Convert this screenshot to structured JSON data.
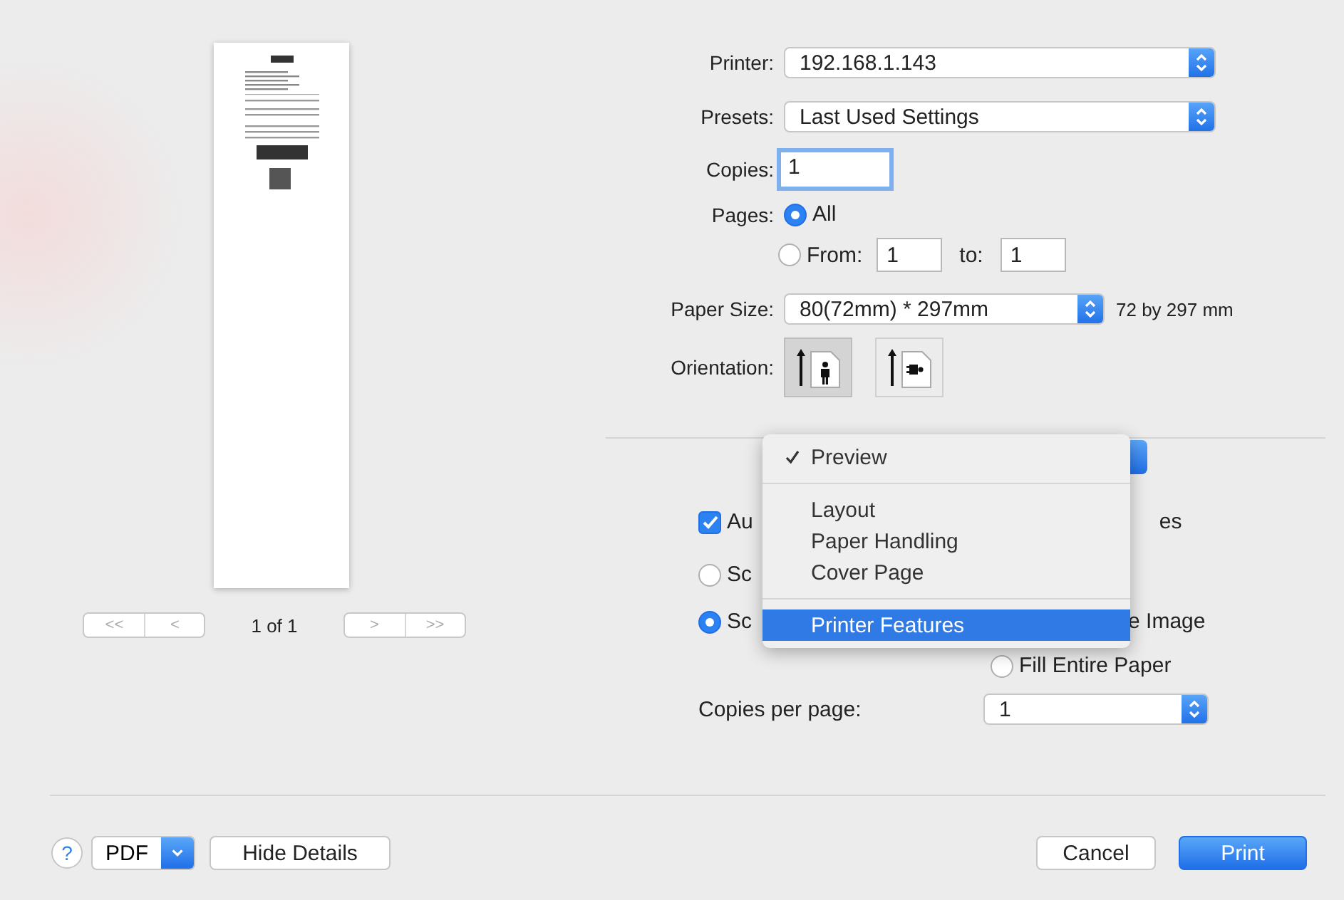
{
  "preview": {
    "page_label": "1 of 1",
    "nav_first": "<<",
    "nav_prev": "<",
    "nav_next": ">",
    "nav_last": ">>"
  },
  "form": {
    "printer": {
      "label": "Printer:",
      "value": "192.168.1.143"
    },
    "presets": {
      "label": "Presets:",
      "value": "Last Used Settings"
    },
    "copies": {
      "label": "Copies:",
      "value": "1"
    },
    "pages": {
      "label": "Pages:",
      "options": [
        {
          "label": "All",
          "selected": true
        },
        {
          "label": "From:",
          "selected": false
        }
      ],
      "from": "1",
      "to_label": "to:",
      "to": "1"
    },
    "paper_size": {
      "label": "Paper Size:",
      "value": "80(72mm) * 297mm",
      "note": "72 by 297 mm"
    },
    "orientation": {
      "label": "Orientation:",
      "options": [
        {
          "kind": "portrait",
          "selected": true
        },
        {
          "kind": "landscape",
          "selected": false
        }
      ]
    }
  },
  "section_menu": {
    "groups": [
      [
        {
          "label": "Preview",
          "checked": true,
          "selected": false
        }
      ],
      [
        {
          "label": "Layout",
          "checked": false,
          "selected": false
        },
        {
          "label": "Paper Handling",
          "checked": false,
          "selected": false
        },
        {
          "label": "Cover Page",
          "checked": false,
          "selected": false
        }
      ],
      [
        {
          "label": "Printer Features",
          "checked": false,
          "selected": true
        }
      ]
    ]
  },
  "options": {
    "auto": {
      "label_start": "Au",
      "label_end": "es",
      "checked": true
    },
    "scale": [
      {
        "label": "Sc",
        "selected": false
      },
      {
        "label": "Sc",
        "selected": true
      }
    ],
    "fit_label": "e Image",
    "fill": {
      "label": "Fill Entire Paper",
      "selected": false
    },
    "copies_per_page": {
      "label": "Copies per page:",
      "value": "1"
    }
  },
  "footer": {
    "help": "?",
    "pdf": "PDF",
    "hide_details": "Hide Details",
    "cancel": "Cancel",
    "print": "Print"
  }
}
